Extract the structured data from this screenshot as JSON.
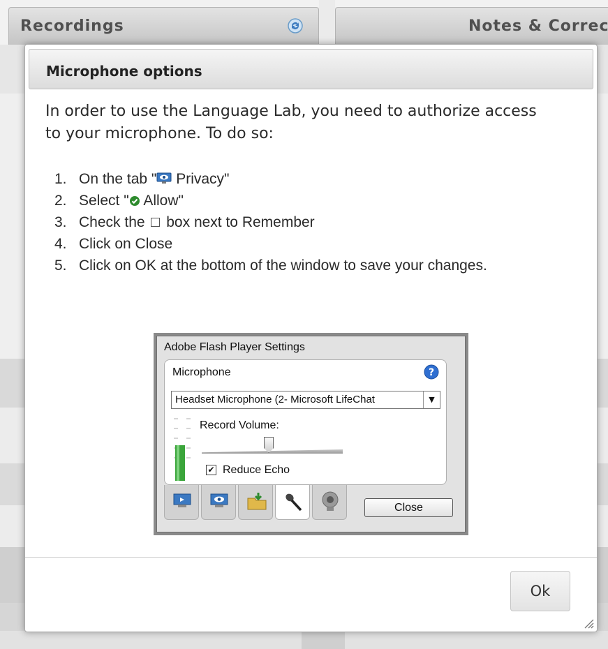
{
  "background": {
    "tabs": {
      "recordings": "Recordings",
      "notes": "Notes & Corrections"
    }
  },
  "dialog": {
    "title": "Microphone options",
    "intro": "In order to use the Language Lab, you need to authorize access to your microphone. To do so:",
    "steps": [
      {
        "num": "1.",
        "before": "On the tab \"",
        "icon": "privacy-tab-icon",
        "after": " Privacy\""
      },
      {
        "num": "2.",
        "before": "Select \"",
        "icon": "allow-check-icon",
        "after": " Allow\""
      },
      {
        "num": "3.",
        "before": "Check the",
        "icon": "checkbox-glyph",
        "after": "box next to Remember"
      },
      {
        "num": "4.",
        "text": "Click on Close"
      },
      {
        "num": "5.",
        "text": "Click on OK at the bottom of the window to save your changes."
      }
    ],
    "ok_label": "Ok"
  },
  "flash_settings": {
    "window_title": "Adobe Flash Player Settings",
    "section_label": "Microphone",
    "device_value": "Headset Microphone (2- Microsoft LifeChat",
    "record_volume_label": "Record Volume:",
    "record_volume_level": 0.45,
    "reduce_echo_label": "Reduce Echo",
    "reduce_echo_checked": true,
    "close_label": "Close",
    "tabs": [
      "display-tab-icon",
      "privacy-tab-icon",
      "storage-tab-icon",
      "microphone-tab-icon",
      "camera-tab-icon"
    ],
    "active_tab": "microphone-tab-icon"
  },
  "colors": {
    "allow_green": "#2e8b2e",
    "meter_green": "#3aa53a",
    "help_blue": "#2f6fd1"
  }
}
